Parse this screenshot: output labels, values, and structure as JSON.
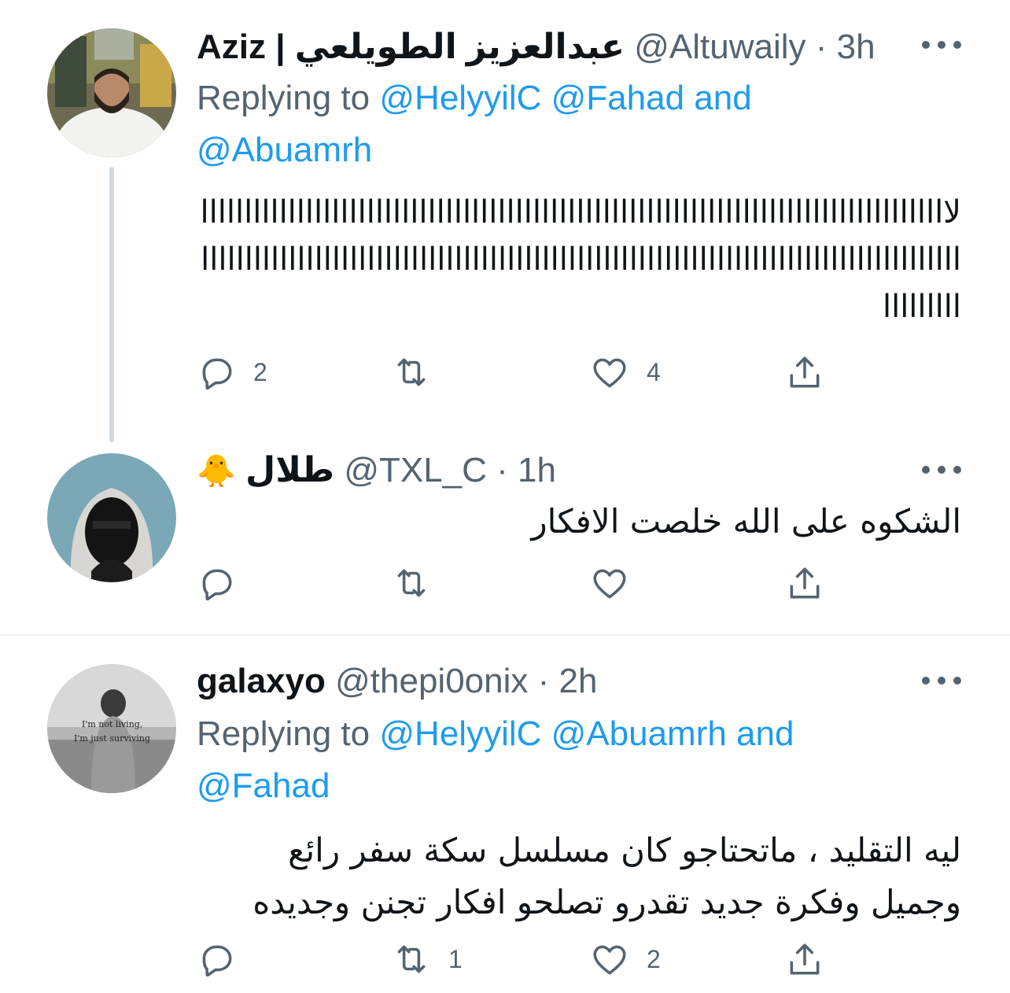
{
  "tweets": [
    {
      "display_name": "Aziz | عبدالعزيز الطويلعي",
      "handle": "@Altuwaily",
      "time": "3h",
      "replying_prefix": "Replying to",
      "reply_mentions_line1": "@HelyyilC @Fahad and",
      "reply_mentions_line2": "@Abuamrh",
      "body": "لاااااااااااااااااااااااااااااااااااااااااااااااااااااااااااااااااااااااااااااااااااااااااااااااااااااااااااااااااااااااااااااااااااااااااااااااااااااااااااااااااااااااااااااااااااااا",
      "reply_count": "2",
      "retweet_count": "",
      "like_count": "4"
    },
    {
      "display_name": "طلال",
      "emoji": "🐥",
      "handle": "@TXL_C",
      "time": "1h",
      "body": "الشكوه على الله خلصت الافكار",
      "reply_count": "",
      "retweet_count": "",
      "like_count": ""
    },
    {
      "display_name": "galaxyo",
      "handle": "@thepi0onix",
      "time": "2h",
      "replying_prefix": "Replying to",
      "reply_mentions_line1": "@HelyyilC @Abuamrh and",
      "reply_mentions_line2": "@Fahad",
      "body_line1": "ليه التقليد ، ماتحتاجو كان مسلسل سكة سفر رائع",
      "body_line2": "وجميل وفكرة جديد تقدرو تصلحو افكار تجنن وجديده",
      "avatar_text_line1": "I'm not living,",
      "avatar_text_line2": "I'm just surviving",
      "reply_count": "",
      "retweet_count": "1",
      "like_count": "2"
    }
  ],
  "colors": {
    "link": "#1d9bf0",
    "muted": "#536471",
    "text": "#0f1419",
    "thread_line": "#cfd9de"
  }
}
